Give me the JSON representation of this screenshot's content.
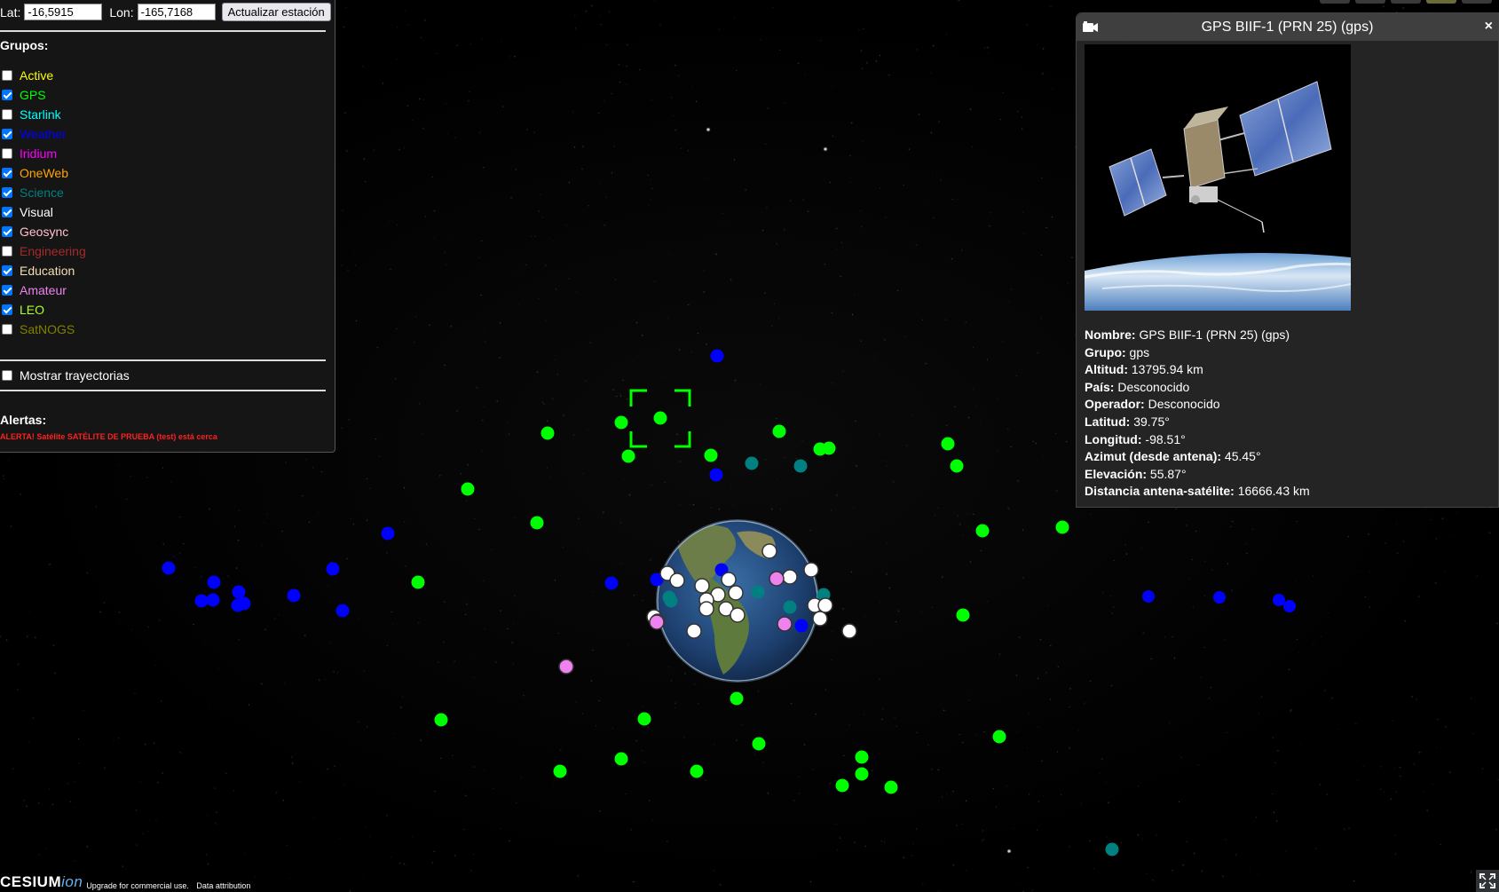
{
  "station": {
    "lat_label": "Lat:",
    "lat_value": "-16,5915",
    "lon_label": "Lon:",
    "lon_value": "-165,7168",
    "update_button": "Actualizar estación"
  },
  "groups_title": "Grupos:",
  "groups": [
    {
      "label": "Active",
      "checked": false,
      "color": "#ffff00"
    },
    {
      "label": "GPS",
      "checked": true,
      "color": "#00ff00"
    },
    {
      "label": "Starlink",
      "checked": false,
      "color": "#00ffff"
    },
    {
      "label": "Weather",
      "checked": true,
      "color": "#0000ff"
    },
    {
      "label": "Iridium",
      "checked": false,
      "color": "#ff00ff"
    },
    {
      "label": "OneWeb",
      "checked": true,
      "color": "#ffa500"
    },
    {
      "label": "Science",
      "checked": true,
      "color": "#008080"
    },
    {
      "label": "Visual",
      "checked": true,
      "color": "#ffffff"
    },
    {
      "label": "Geosync",
      "checked": true,
      "color": "#ffc0cb"
    },
    {
      "label": "Engineering",
      "checked": false,
      "color": "#a52a2a"
    },
    {
      "label": "Education",
      "checked": true,
      "color": "#f5deb3"
    },
    {
      "label": "Amateur",
      "checked": true,
      "color": "#ee82ee"
    },
    {
      "label": "LEO",
      "checked": true,
      "color": "#adff2f"
    },
    {
      "label": "SatNOGS",
      "checked": false,
      "color": "#808000"
    }
  ],
  "trajectories": {
    "label": "Mostrar trayectorias",
    "checked": false
  },
  "alerts_title": "Alertas:",
  "alert_message": "ALERTA! Satélite SATÉLITE DE PRUEBA (test) está cerca",
  "infobox": {
    "title": "GPS BIIF-1 (PRN 25) (gps)",
    "fields": [
      {
        "key": "Nombre:",
        "value": "GPS BIIF-1 (PRN 25) (gps)"
      },
      {
        "key": "Grupo:",
        "value": "gps"
      },
      {
        "key": "Altitud:",
        "value": "13795.94 km"
      },
      {
        "key": "País:",
        "value": "Desconocido"
      },
      {
        "key": "Operador:",
        "value": "Desconocido"
      },
      {
        "key": "Latitud:",
        "value": "39.75°"
      },
      {
        "key": "Longitud:",
        "value": "-98.51°"
      },
      {
        "key": "Azimut (desde antena):",
        "value": "45.45°"
      },
      {
        "key": "Elevación:",
        "value": "55.87°"
      },
      {
        "key": "Distancia antena-satélite:",
        "value": "16666.43 km"
      }
    ]
  },
  "credits": {
    "logo_main": "CESIUM",
    "logo_ion": "ion",
    "link_upgrade": "Upgrade for commercial use.",
    "link_attribution": "Data attribution"
  },
  "colors": {
    "gps": "#00ff00",
    "weather": "#0000ff",
    "science": "#008080",
    "visual": "#ffffff",
    "amateur": "#ee82ee",
    "selection": "#00ff00",
    "alert": "#ff2020"
  },
  "icons": {
    "camera": "camera-icon",
    "close": "close-icon",
    "fullscreen": "fullscreen-icon"
  }
}
